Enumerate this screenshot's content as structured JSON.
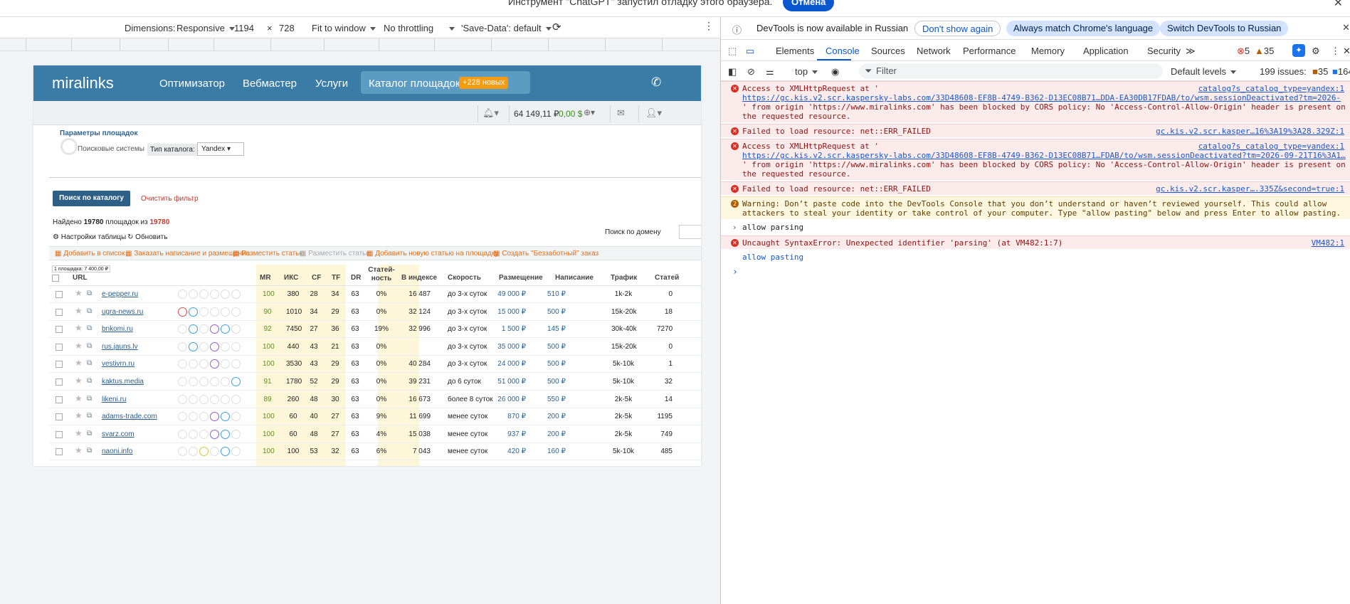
{
  "banner": {
    "text": "Инструмент \"ChatGPT\" запустил отладку этого браузера.",
    "cancel": "Отмена",
    "close": "✕"
  },
  "device_toolbar": {
    "dimensions_label": "Dimensions:",
    "preset": "Responsive",
    "width": "1194",
    "times": "×",
    "height": "728",
    "zoom": "Fit to window",
    "throttle": "No throttling",
    "save_data": "'Save-Data': default"
  },
  "site": {
    "logo": "miralinks",
    "nav": [
      "Оптимизатор",
      "Вебмастер",
      "Услуги"
    ],
    "nav_active": "Каталог площадок",
    "badge": "+228 новых",
    "balance_rub": "64 149,11 ₽",
    "balance_usd": "0,00 $",
    "filter_title": "Параметры площадок",
    "search_engines": "Поисковые системы",
    "catalog_type_label": "Тип каталога:",
    "catalog_type_value": "Yandex",
    "search_button": "Поиск по каталогу",
    "clear_filter": "Очистить фильтр",
    "found_prefix": "Найдено",
    "found_count": "19780",
    "found_mid": "площадок из",
    "found_total": "19780",
    "domain_search": "Поиск по домену",
    "table_settings": "Настройки таблицы",
    "refresh": "Обновить",
    "actions": [
      "Добавить в список",
      "Заказать написание и размещение",
      "Разместить статью",
      "Разместить статьи",
      "Добавить новую статью на площадку",
      "Создать \"Беззаботный\" заказ"
    ],
    "selection_note": "1 площадка: 7 400,00 ₽",
    "columns": [
      "URL",
      "MR",
      "ИКС",
      "CF",
      "TF",
      "DR",
      "Статей-ность",
      "В индексе",
      "Скорость",
      "Размещение",
      "Написание",
      "Трафик",
      "Статей"
    ],
    "rows": [
      {
        "url": "e-pepper.ru",
        "mr": "100",
        "iks": "380",
        "cf": "28",
        "tf": "34",
        "dr": "63",
        "st": "0%",
        "idx": "16 487",
        "speed": "до 3-х суток",
        "place": "49 000 ₽",
        "write": "510 ₽",
        "traffic": "1k-2k",
        "count": "0"
      },
      {
        "url": "ugra-news.ru",
        "mr": "90",
        "iks": "1010",
        "cf": "34",
        "tf": "29",
        "dr": "63",
        "st": "0%",
        "idx": "32 124",
        "speed": "до 3-х суток",
        "place": "15 000 ₽",
        "write": "500 ₽",
        "traffic": "15k-20k",
        "count": "18"
      },
      {
        "url": "bnkomi.ru",
        "mr": "92",
        "iks": "7450",
        "cf": "27",
        "tf": "36",
        "dr": "63",
        "st": "19%",
        "idx": "32 996",
        "speed": "до 3-х суток",
        "place": "1 500 ₽",
        "write": "145 ₽",
        "traffic": "30k-40k",
        "count": "7270"
      },
      {
        "url": "rus.jauns.lv",
        "mr": "100",
        "iks": "440",
        "cf": "43",
        "tf": "21",
        "dr": "63",
        "st": "0%",
        "idx": "",
        "speed": "до 3-х суток",
        "place": "35 000 ₽",
        "write": "500 ₽",
        "traffic": "15k-20k",
        "count": "0"
      },
      {
        "url": "vestivrn.ru",
        "mr": "100",
        "iks": "3530",
        "cf": "43",
        "tf": "29",
        "dr": "63",
        "st": "0%",
        "idx": "40 284",
        "speed": "до 3-х суток",
        "place": "24 000 ₽",
        "write": "500 ₽",
        "traffic": "5k-10k",
        "count": "1"
      },
      {
        "url": "kaktus.media",
        "mr": "91",
        "iks": "1780",
        "cf": "52",
        "tf": "29",
        "dr": "63",
        "st": "0%",
        "idx": "39 231",
        "speed": "до 6 суток",
        "place": "51 000 ₽",
        "write": "500 ₽",
        "traffic": "5k-10k",
        "count": "32"
      },
      {
        "url": "likeni.ru",
        "mr": "89",
        "iks": "260",
        "cf": "48",
        "tf": "30",
        "dr": "63",
        "st": "0%",
        "idx": "16 673",
        "speed": "более 8 суток",
        "place": "26 000 ₽",
        "write": "550 ₽",
        "traffic": "2k-5k",
        "count": "14"
      },
      {
        "url": "adams-trade.com",
        "mr": "100",
        "iks": "60",
        "cf": "40",
        "tf": "27",
        "dr": "63",
        "st": "9%",
        "idx": "11 699",
        "speed": "менее суток",
        "place": "870 ₽",
        "write": "200 ₽",
        "traffic": "2k-5k",
        "count": "1195"
      },
      {
        "url": "svarz.com",
        "mr": "100",
        "iks": "60",
        "cf": "48",
        "tf": "27",
        "dr": "63",
        "st": "4%",
        "idx": "15 038",
        "speed": "менее суток",
        "place": "937 ₽",
        "write": "200 ₽",
        "traffic": "2k-5k",
        "count": "749"
      },
      {
        "url": "naoni.info",
        "mr": "100",
        "iks": "100",
        "cf": "53",
        "tf": "32",
        "dr": "63",
        "st": "6%",
        "idx": "7 043",
        "speed": "менее суток",
        "place": "420 ₽",
        "write": "160 ₽",
        "traffic": "5k-10k",
        "count": "485"
      }
    ]
  },
  "devtools": {
    "info_text": "DevTools is now available in Russian",
    "dont_show": "Don't show again",
    "match_lang": "Always match Chrome's language",
    "switch_lang": "Switch DevTools to Russian",
    "tabs": [
      "Elements",
      "Console",
      "Sources",
      "Network",
      "Performance",
      "Memory",
      "Application",
      "Security"
    ],
    "active_tab": "Console",
    "more_tabs": "≫",
    "error_count": "5",
    "warn_count": "35",
    "context": "top",
    "filter_placeholder": "Filter",
    "levels": "Default levels",
    "issues_label": "199 issues:",
    "issues_warn": "35",
    "issues_info": "164",
    "messages": [
      {
        "type": "error",
        "lines": [
          "Access to XMLHttpRequest at '",
          "https://gc.kis.v2.scr.kaspersky-labs.com/33D48608-EF8B-4749-B362-D13EC08B71…DDA-EA30DB17FDAB/to/wsm.sessionDeactivated?tm=2026-",
          "' from origin 'https://www.miralinks.com' has been blocked by CORS policy: No 'Access-Control-Allow-Origin' header is present on",
          "the requested resource."
        ],
        "source": "catalog?s_catalog_type=yandex:1"
      },
      {
        "type": "error",
        "lines": [
          "Failed to load resource: net::ERR_FAILED"
        ],
        "source": "gc.kis.v2.scr.kasper…16%3A19%3A28.329Z:1"
      },
      {
        "type": "error",
        "lines": [
          "Access to XMLHttpRequest at '",
          "https://gc.kis.v2.scr.kaspersky-labs.com/33D48608-EF8B-4749-B362-D13EC08B71…FDAB/to/wsm.sessionDeactivated?tm=2026-09-21T16%3A1…",
          "' from origin 'https://www.miralinks.com' has been blocked by CORS policy: No 'Access-Control-Allow-Origin' header is present on",
          "the requested resource."
        ],
        "source": "catalog?s_catalog_type=yandex:1"
      },
      {
        "type": "error",
        "lines": [
          "Failed to load resource: net::ERR_FAILED"
        ],
        "source": "gc.kis.v2.scr.kasper….335Z&second=true:1"
      },
      {
        "type": "warn",
        "badge": "2",
        "lines": [
          "Warning: Don’t paste code into the DevTools Console that you don’t understand or haven’t reviewed yourself. This could allow",
          "attackers to steal your identity or take control of your computer. Type \"allow pasting\" below and press Enter to allow pasting."
        ]
      },
      {
        "type": "input",
        "lines": [
          "allow parsing"
        ]
      },
      {
        "type": "error",
        "lines": [
          "Uncaught SyntaxError: Unexpected identifier 'parsing' (at VM482:1:7)"
        ],
        "source": "VM482:1"
      },
      {
        "type": "output",
        "lines": [
          "allow pasting"
        ]
      }
    ],
    "prompt": "›"
  }
}
